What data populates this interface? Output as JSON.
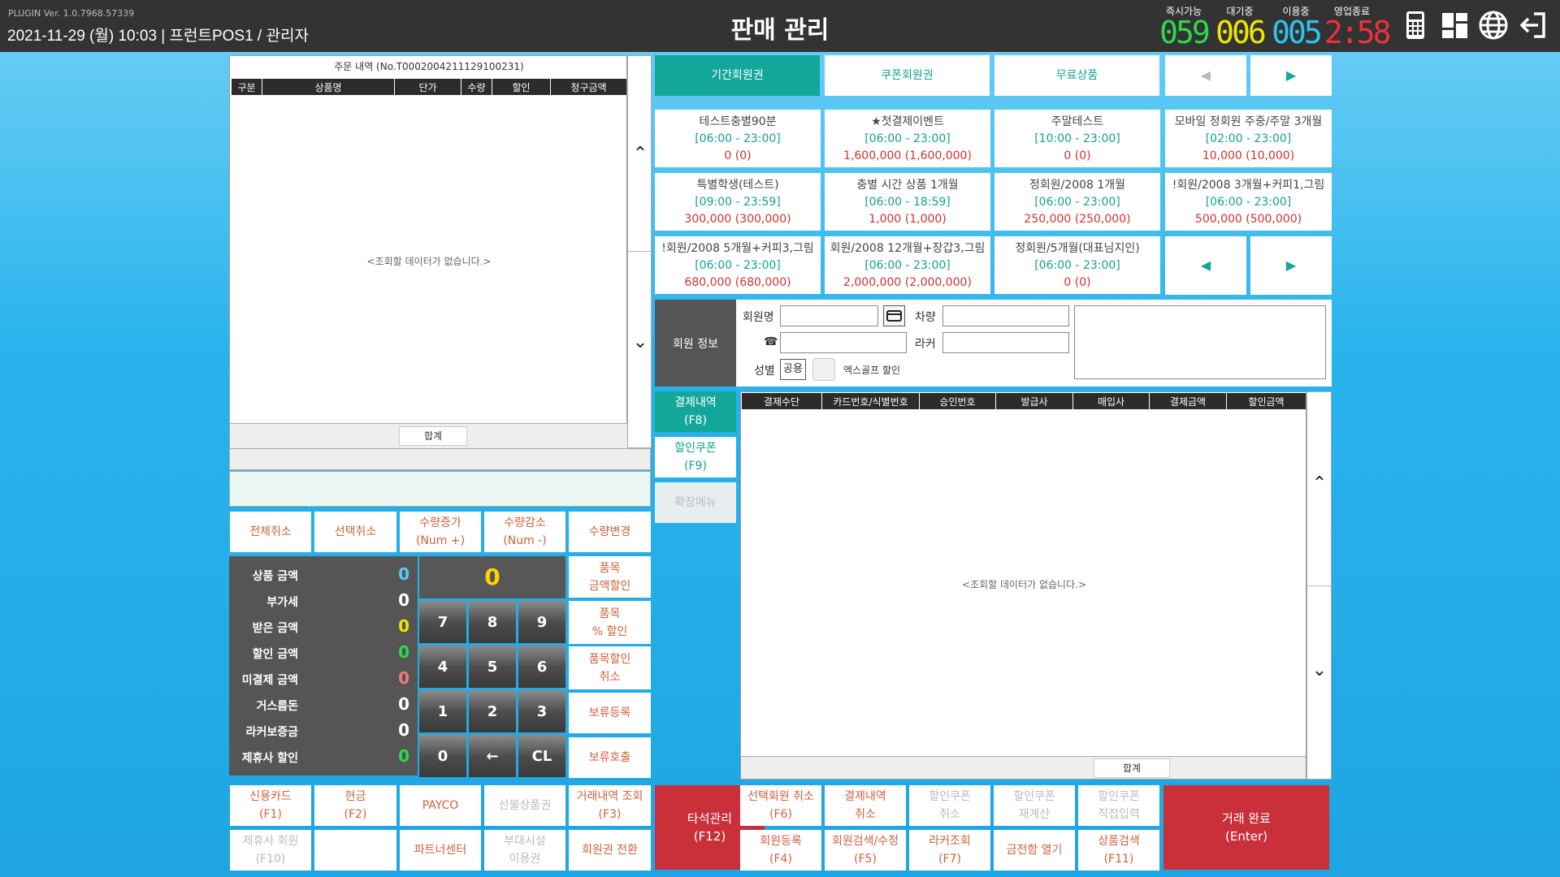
{
  "header": {
    "version": "PLUGIN Ver. 1.0.7968.57339",
    "datetime": "2021-11-29 (월) 10:03 | 프런트POS1 / 관리자",
    "title": "판매 관리",
    "counters": [
      {
        "label": "즉시가능",
        "value": "059",
        "color": "#2bd94a"
      },
      {
        "label": "대기중",
        "value": "006",
        "color": "#f2e500"
      },
      {
        "label": "이용중",
        "value": "005",
        "color": "#2fc3f0"
      },
      {
        "label": "영업종료",
        "value": "2:58",
        "color": "#f0303a"
      }
    ],
    "icons": [
      "calculator-icon",
      "dashboard-icon",
      "globe-icon",
      "logout-icon"
    ]
  },
  "order": {
    "title": "주문 내역 (No.T0002004211129100231)",
    "columns": [
      "구분",
      "상품명",
      "단가",
      "수량",
      "할인",
      "청구금액"
    ],
    "empty": "<조회할 데이터가 없습니다.>",
    "total_label": "합계"
  },
  "actions": {
    "cancel_all": "전체취소",
    "cancel_sel": "선택취소",
    "qty_up": "수량증가\n(Num +)",
    "qty_down": "수량감소\n(Num -)",
    "qty_change": "수량변경"
  },
  "summary": [
    {
      "label": "상품 금액",
      "value": "0",
      "color": "#55c8f5"
    },
    {
      "label": "부가세",
      "value": "0",
      "color": "#ffffff"
    },
    {
      "label": "받은 금액",
      "value": "0",
      "color": "#f2e500"
    },
    {
      "label": "할인 금액",
      "value": "0",
      "color": "#2bd94a"
    },
    {
      "label": "미결제 금액",
      "value": "0",
      "color": "#f07a7a"
    },
    {
      "label": "거스름돈",
      "value": "0",
      "color": "#ffffff"
    },
    {
      "label": "라커보증금",
      "value": "0",
      "color": "#ffffff"
    },
    {
      "label": "제휴사 할인",
      "value": "0",
      "color": "#2bd94a"
    }
  ],
  "keypad": {
    "display": "0",
    "keys": [
      "7",
      "8",
      "9",
      "4",
      "5",
      "6",
      "1",
      "2",
      "3",
      "0",
      "←",
      "CL"
    ]
  },
  "side_actions": [
    "품목\n금액할인",
    "품목\n% 할인",
    "품목할인\n취소",
    "보류등록",
    "보류호출"
  ],
  "payments": [
    {
      "label": "신용카드\n(F1)",
      "enabled": true
    },
    {
      "label": "현금\n(F2)",
      "enabled": true
    },
    {
      "label": "PAYCO",
      "enabled": true
    },
    {
      "label": "선불상품권",
      "enabled": false
    },
    {
      "label": "거래내역 조회\n(F3)",
      "enabled": true
    },
    {
      "label": "제휴사 회원\n(F10)",
      "enabled": false
    },
    {
      "label": "",
      "enabled": true
    },
    {
      "label": "파트너센터",
      "enabled": true
    },
    {
      "label": "부대시설\n이용권",
      "enabled": false
    },
    {
      "label": "회원권 전환",
      "enabled": true
    }
  ],
  "tabs": {
    "items": [
      "기간회원권",
      "쿠폰회원권",
      "무료상품"
    ],
    "prev": "◀",
    "next": "▶"
  },
  "products": [
    {
      "name": "테스트충별90분",
      "time": "[06:00 - 23:00]",
      "price": "0 (0)"
    },
    {
      "name": "★첫결제이벤트",
      "time": "[06:00 - 23:00]",
      "price": "1,600,000 (1,600,000)"
    },
    {
      "name": "주말테스트",
      "time": "[10:00 - 23:00]",
      "price": "0 (0)"
    },
    {
      "name": "모바일 정회원 주중/주말 3개월",
      "time": "[02:00 - 23:00]",
      "price": "10,000 (10,000)"
    },
    {
      "name": "특별학생(테스트)",
      "time": "[09:00 - 23:59]",
      "price": "300,000 (300,000)"
    },
    {
      "name": "충별 시간 상품 1개월",
      "time": "[06:00 - 18:59]",
      "price": "1,000 (1,000)"
    },
    {
      "name": "정회원/2008 1개월",
      "time": "[06:00 - 23:00]",
      "price": "250,000 (250,000)"
    },
    {
      "name": "!회원/2008 3개월+커피1,그림",
      "time": "[06:00 - 23:00]",
      "price": "500,000 (500,000)"
    },
    {
      "name": "!회원/2008 5개월+커피3,그림",
      "time": "[06:00 - 23:00]",
      "price": "680,000 (680,000)"
    },
    {
      "name": "회원/2008 12개월+장갑3,그림",
      "time": "[06:00 - 23:00]",
      "price": "2,000,000 (2,000,000)"
    },
    {
      "name": "정회원/5개월(대표님지인)",
      "time": "[06:00 - 23:00]",
      "price": "0 (0)"
    }
  ],
  "member": {
    "section_label": "회원 정보",
    "name_label": "회원명",
    "car_label": "차량",
    "phone_icon": "☎",
    "locker_label": "라커",
    "gender_label": "성별",
    "gender_value": "공용",
    "discount_label": "엑스골프 할인"
  },
  "pay_tabs": [
    {
      "label": "결제내역\n(F8)",
      "active": true
    },
    {
      "label": "할인쿠폰\n(F9)",
      "active": false
    },
    {
      "label": "확장메뉴",
      "active": false
    }
  ],
  "payment_table": {
    "columns": [
      "결제수단",
      "카드번호/식별번호",
      "승인번호",
      "발급사",
      "매입사",
      "결제금액",
      "할인금액"
    ],
    "empty": "<조회할 데이터가 없습니다.>",
    "total_label": "합계"
  },
  "bottom": {
    "seat": "타석관리\n(F12)",
    "complete": "거래 완료\n(Enter)",
    "row1": [
      {
        "label": "선택회원 취소\n(F6)",
        "enabled": true
      },
      {
        "label": "결제내역\n취소",
        "enabled": true
      },
      {
        "label": "할인쿠폰\n취소",
        "enabled": false
      },
      {
        "label": "할인쿠폰\n재계산",
        "enabled": false
      },
      {
        "label": "할인쿠폰\n직접입력",
        "enabled": false
      }
    ],
    "row2": [
      {
        "label": "회원등록\n(F4)",
        "enabled": true
      },
      {
        "label": "회원검색/수정\n(F5)",
        "enabled": true
      },
      {
        "label": "라커조회\n(F7)",
        "enabled": true
      },
      {
        "label": "금전함 열기",
        "enabled": true
      },
      {
        "label": "상품검색\n(F11)",
        "enabled": true
      }
    ]
  }
}
